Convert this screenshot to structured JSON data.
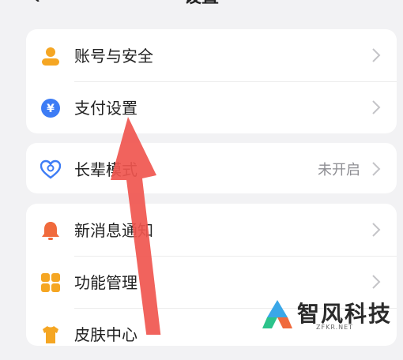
{
  "header": {
    "title": "设置"
  },
  "groups": [
    {
      "items": [
        {
          "label": "账号与安全",
          "icon": "user-icon",
          "color": "#f5a623"
        },
        {
          "label": "支付设置",
          "icon": "yuan-icon",
          "color": "#3d7cf5"
        }
      ]
    },
    {
      "items": [
        {
          "label": "长辈模式",
          "status": "未开启",
          "icon": "heart-icon",
          "color": "#3d7cf5"
        }
      ]
    },
    {
      "items": [
        {
          "label": "新消息通知",
          "icon": "bell-icon",
          "color": "#f06a3c"
        },
        {
          "label": "功能管理",
          "icon": "grid-icon",
          "color": "#f5a623"
        },
        {
          "label": "皮肤中心",
          "icon": "skin-icon",
          "color": "#f5a623"
        }
      ]
    }
  ],
  "watermark": {
    "text": "智风科技",
    "sub": "ZFKR.NET"
  },
  "colors": {
    "arrow": "#f0564f",
    "background": "#f2f2f4"
  }
}
